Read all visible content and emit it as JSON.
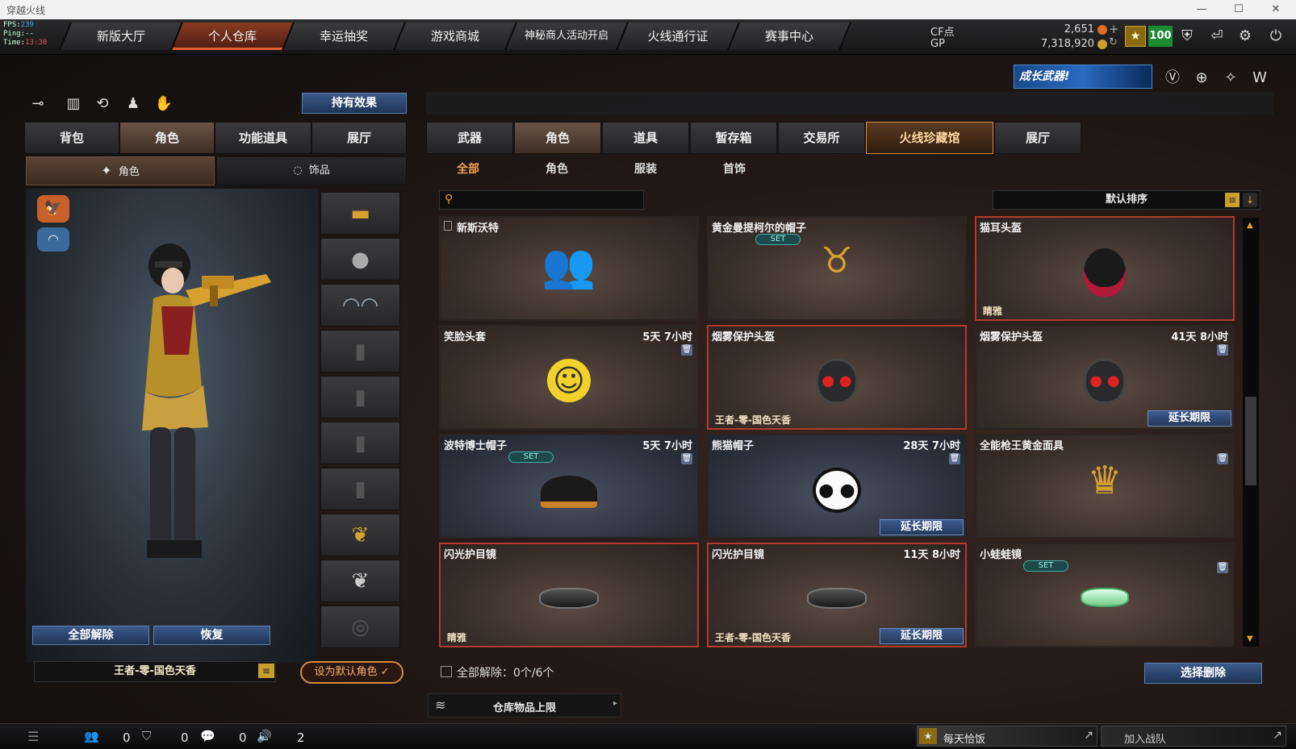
{
  "window": {
    "title": "穿越火线"
  },
  "stats": {
    "fps_label": "FPS:",
    "fps": "239",
    "ping_label": "Ping:",
    "ping": "--",
    "time_label": "Time:",
    "time": "13:30"
  },
  "nav": {
    "tabs": [
      {
        "label": "新版大厅"
      },
      {
        "label": "个人仓库"
      },
      {
        "label": "幸运抽奖"
      },
      {
        "label": "游戏商城"
      },
      {
        "label": "神秘商人活动开启"
      },
      {
        "label": "火线通行证"
      },
      {
        "label": "赛事中心"
      }
    ]
  },
  "currency": {
    "cf_label": "CF点",
    "cf_value": "2,651",
    "gp_label": "GP",
    "gp_value": "7,318,920",
    "level": "100"
  },
  "banner": {
    "text": "成长武器!"
  },
  "left": {
    "effects_button": "持有效果",
    "tabs": [
      "背包",
      "角色",
      "功能道具",
      "展厅"
    ],
    "subtabs": [
      "角色",
      "饰品"
    ],
    "unequip_all": "全部解除",
    "restore": "恢复",
    "character_name": "王者-零-国色天香",
    "set_default": "设为默认角色"
  },
  "right": {
    "tabs": [
      "武器",
      "角色",
      "道具",
      "暂存箱",
      "交易所",
      "火线珍藏馆",
      "展厅"
    ],
    "subtabs": [
      "全部",
      "角色",
      "服装",
      "首饰"
    ],
    "search_placeholder": "",
    "sort_label": "默认排序",
    "items": [
      {
        "name": "新斯沃特",
        "time": "",
        "set": false,
        "owner": "",
        "extend": "",
        "trash": false,
        "icon": "soldiers"
      },
      {
        "name": "黄金曼提柯尔的帽子",
        "time": "",
        "set": true,
        "owner": "",
        "extend": "",
        "trash": false,
        "icon": "gold-horns"
      },
      {
        "name": "猫耳头盔",
        "time": "",
        "set": false,
        "owner": "睛雅",
        "extend": "",
        "trash": false,
        "icon": "cat-helmet"
      },
      {
        "name": "笑脸头套",
        "time": "5天 7小时",
        "set": false,
        "owner": "",
        "extend": "",
        "trash": true,
        "icon": "smiley"
      },
      {
        "name": "烟雾保护头盔",
        "time": "",
        "set": false,
        "owner": "王者-零-国色天香",
        "extend": "",
        "trash": false,
        "icon": "gas-helmet"
      },
      {
        "name": "烟雾保护头盔",
        "time": "41天 8小时",
        "set": false,
        "owner": "",
        "extend": "延长期限",
        "trash": true,
        "icon": "gas-helmet"
      },
      {
        "name": "波特博士帽子",
        "time": "5天 7小时",
        "set": true,
        "owner": "",
        "extend": "",
        "trash": true,
        "icon": "cap"
      },
      {
        "name": "熊猫帽子",
        "time": "28天 7小时",
        "set": false,
        "owner": "",
        "extend": "延长期限",
        "trash": true,
        "icon": "panda"
      },
      {
        "name": "全能枪王黄金面具",
        "time": "",
        "set": false,
        "owner": "",
        "extend": "",
        "trash": true,
        "icon": "gold-mask"
      },
      {
        "name": "闪光护目镜",
        "time": "",
        "set": false,
        "owner": "睛雅",
        "extend": "",
        "trash": false,
        "icon": "goggles"
      },
      {
        "name": "闪光护目镜",
        "time": "11天 8小时",
        "set": false,
        "owner": "王者-零-国色天香",
        "extend": "延长期限",
        "trash": false,
        "icon": "goggles"
      },
      {
        "name": "小蛙蛙镜",
        "time": "",
        "set": true,
        "owner": "",
        "extend": "",
        "trash": true,
        "icon": "frog-goggles"
      }
    ],
    "set_badge": "SET",
    "unequip_summary": "全部解除：0个/6个",
    "select_delete": "选择删除",
    "storage_limit": "仓库物品上限"
  },
  "statusbar": {
    "c1": "0",
    "c2": "0",
    "c3": "0",
    "c4": "2",
    "daily": "每天恰饭",
    "join_team": "加入战队"
  }
}
